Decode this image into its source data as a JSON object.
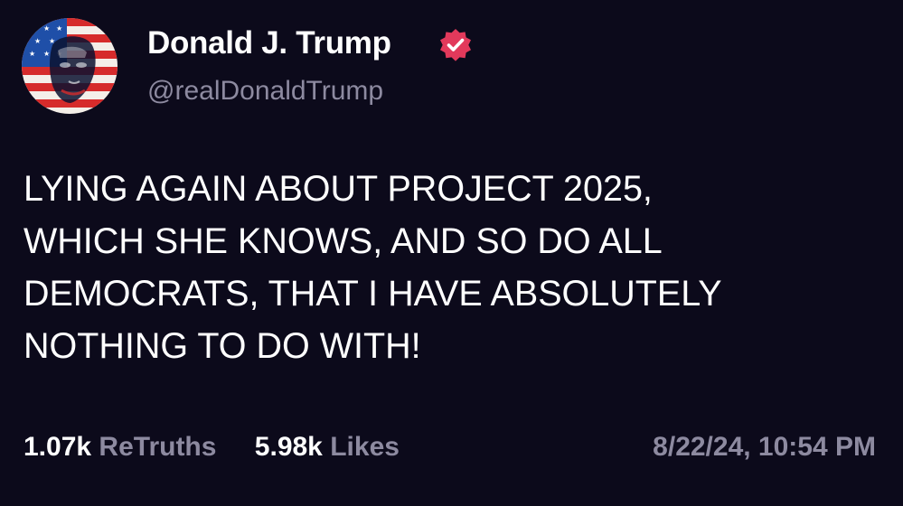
{
  "author": {
    "display_name": "Donald J. Trump",
    "handle": "@realDonaldTrump",
    "avatar_icon": "flag-portrait-avatar",
    "verified_icon": "verified-badge-icon"
  },
  "post": {
    "text": "LYING AGAIN ABOUT PROJECT 2025,\nWHICH SHE KNOWS, AND SO DO ALL\nDEMOCRATS, THAT I HAVE ABSOLUTELY\nNOTHING TO DO WITH!"
  },
  "stats": {
    "retruths_count": "1.07k",
    "retruths_label": "ReTruths",
    "likes_count": "5.98k",
    "likes_label": "Likes"
  },
  "timestamp": "8/22/24, 10:54 PM",
  "colors": {
    "background": "#0c0a1b",
    "muted_text": "#8d8aa0",
    "verified_badge": "#e2395b"
  }
}
